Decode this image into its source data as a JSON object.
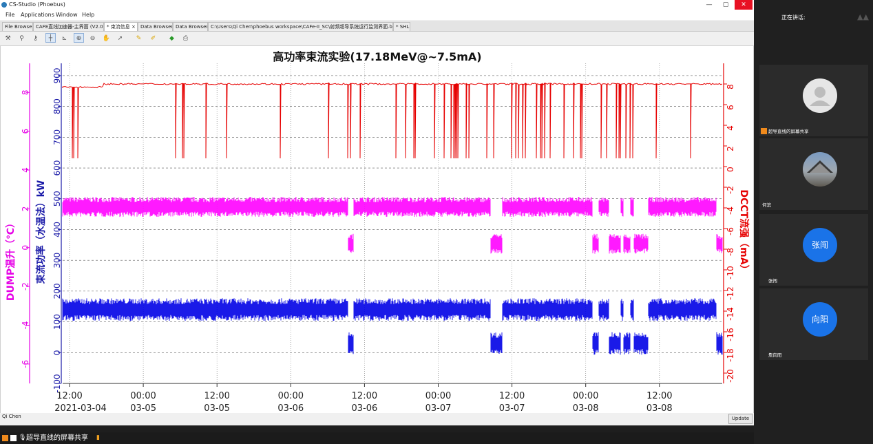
{
  "window": {
    "title": "CS-Studio (Phoebus)",
    "min": "—",
    "max": "▢",
    "close": "✕"
  },
  "menu": [
    "File",
    "Applications",
    "Window",
    "Help"
  ],
  "tabs": [
    {
      "label": "File Browser"
    },
    {
      "label": "CAFE直线加速器-主界面 (V2.0)"
    },
    {
      "label": "* 束流信息 ×"
    },
    {
      "label": "Data Browser"
    },
    {
      "label": "Data Browser"
    },
    {
      "label": "C:\\Users\\Qi Chen\\phoebus workspace\\CAFe-II_SC\\射频超导系统运行监测界面.bob"
    },
    {
      "label": "* SHL"
    }
  ],
  "toolbar_icons": [
    "tool-a-icon",
    "tool-b-icon",
    "tool-c-icon",
    "crosshair-icon",
    "axis-icon",
    "zoom-in-icon",
    "zoom-out-icon",
    "pan-icon",
    "pointer-icon",
    "bookmark-a-icon",
    "bookmark-b-icon",
    "undo-icon",
    "print-icon"
  ],
  "chart_data": {
    "type": "line",
    "title": "高功率束流实验(17.18MeV@~7.5mA)",
    "x_ticks": [
      {
        "time": "12:00",
        "date": "2021-03-04"
      },
      {
        "time": "00:00",
        "date": "03-05"
      },
      {
        "time": "12:00",
        "date": "03-05"
      },
      {
        "time": "00:00",
        "date": "03-06"
      },
      {
        "time": "12:00",
        "date": "03-06"
      },
      {
        "time": "00:00",
        "date": "03-07"
      },
      {
        "time": "12:00",
        "date": "03-07"
      },
      {
        "time": "00:00",
        "date": "03-08"
      },
      {
        "time": "12:00",
        "date": "03-08"
      }
    ],
    "axes": {
      "left_outer": {
        "label": "DUMP温升（℃）",
        "color": "#e600e6",
        "range": [
          -7,
          9.5
        ],
        "ticks": [
          -6,
          -4,
          -2,
          0,
          2,
          4,
          6,
          8
        ]
      },
      "left_inner": {
        "label": "束流功率（水温法）kW",
        "color": "#1a1aa8",
        "range": [
          -100,
          940
        ],
        "ticks": [
          -100,
          0,
          100,
          200,
          300,
          400,
          500,
          600,
          700,
          800,
          900
        ]
      },
      "right": {
        "label": "DCCT流强（mA）",
        "color": "#e60000",
        "range": [
          -21,
          10
        ],
        "ticks": [
          8,
          6,
          4,
          2,
          0,
          -2,
          -4,
          -6,
          -8,
          -10,
          -12,
          -14,
          -16,
          -18,
          -20
        ]
      }
    },
    "series": [
      {
        "color": "#e60000",
        "axis": "right",
        "baseline": 8.0,
        "dip_value": 0.8
      },
      {
        "color": "#ff00ff",
        "axis": "left_outer",
        "baseline": 2.1
      },
      {
        "color": "#0000e6",
        "axis": "left_inner",
        "baseline": 140
      }
    ],
    "grid": true
  },
  "status": {
    "user": "Qi Chen",
    "update": "Update"
  },
  "share_text": "超导直线的屏幕共享",
  "side": {
    "speaking": "正在讲话:",
    "tiles": [
      {
        "name": "超导直线的屏幕共享",
        "avatar": "photo-gray",
        "text": ""
      },
      {
        "name": "何滨",
        "avatar": "photo-landscape",
        "text": ""
      },
      {
        "name": "张闯",
        "avatar": "text",
        "text": "张闯"
      },
      {
        "name": "詹向阳",
        "avatar": "text",
        "text": "向阳"
      }
    ]
  }
}
